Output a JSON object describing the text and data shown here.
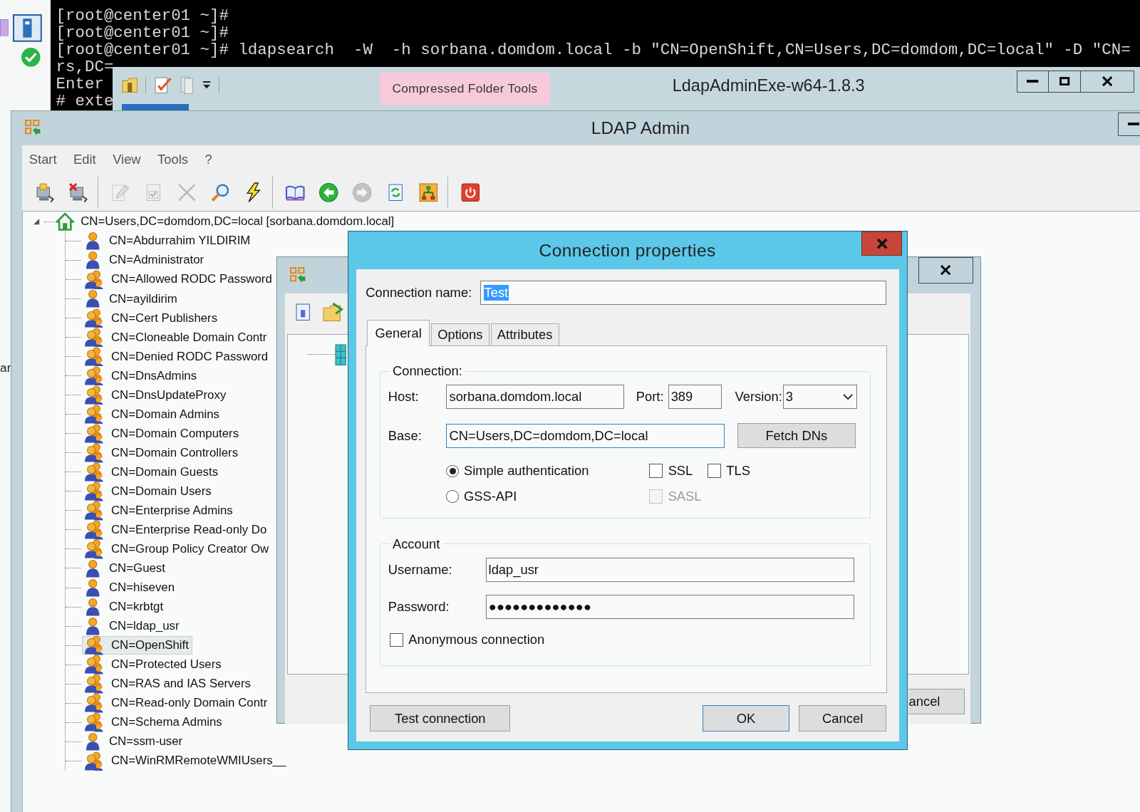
{
  "left_window": {
    "text_fragment": "ar"
  },
  "terminal": {
    "lines": [
      "[root@center01 ~]#",
      "[root@center01 ~]#",
      "[root@center01 ~]# ldapsearch  -W  -h sorbana.domdom.local -b \"CN=OpenShift,CN=Users,DC=domdom,DC=local\" -D \"CN=",
      "rs,DC=",
      "Enter",
      "# exte"
    ]
  },
  "explorer_window": {
    "ribbon_tab": "Compressed Folder Tools",
    "title": "LdapAdminExe-w64-1.8.3"
  },
  "ldap_admin": {
    "title": "LDAP Admin",
    "menu": [
      "Start",
      "Edit",
      "View",
      "Tools",
      "?"
    ],
    "toolbar_groups": [
      [
        {
          "kind": "connect",
          "disabled": false
        },
        {
          "kind": "disconnect",
          "disabled": false
        }
      ],
      [
        {
          "kind": "edit",
          "disabled": true
        },
        {
          "kind": "properties",
          "disabled": true
        },
        {
          "kind": "delete",
          "disabled": true
        },
        {
          "kind": "search",
          "disabled": false
        },
        {
          "kind": "execute",
          "disabled": false
        }
      ],
      [
        {
          "kind": "dictionary",
          "disabled": false
        },
        {
          "kind": "back",
          "disabled": false
        },
        {
          "kind": "forward",
          "disabled": true
        },
        {
          "kind": "refresh",
          "disabled": false
        },
        {
          "kind": "schema",
          "disabled": false
        }
      ],
      [
        {
          "kind": "exit",
          "disabled": false
        }
      ]
    ],
    "tree": {
      "label": "CN=Users,DC=domdom,DC=local [sorbana.domdom.local]",
      "expanded": true,
      "children": [
        {
          "label": "CN=Abdurrahim YILDIRIM",
          "kind": "user",
          "selected": false
        },
        {
          "label": "CN=Administrator",
          "kind": "user",
          "selected": false
        },
        {
          "label": "CN=Allowed RODC Password",
          "kind": "group",
          "selected": false
        },
        {
          "label": "CN=ayildirim",
          "kind": "user",
          "selected": false
        },
        {
          "label": "CN=Cert Publishers",
          "kind": "group",
          "selected": false
        },
        {
          "label": "CN=Cloneable Domain Contr",
          "kind": "group",
          "selected": false
        },
        {
          "label": "CN=Denied RODC Password",
          "kind": "group",
          "selected": false
        },
        {
          "label": "CN=DnsAdmins",
          "kind": "group",
          "selected": false
        },
        {
          "label": "CN=DnsUpdateProxy",
          "kind": "group",
          "selected": false
        },
        {
          "label": "CN=Domain Admins",
          "kind": "group",
          "selected": false
        },
        {
          "label": "CN=Domain Computers",
          "kind": "group",
          "selected": false
        },
        {
          "label": "CN=Domain Controllers",
          "kind": "group",
          "selected": false
        },
        {
          "label": "CN=Domain Guests",
          "kind": "group",
          "selected": false
        },
        {
          "label": "CN=Domain Users",
          "kind": "group",
          "selected": false
        },
        {
          "label": "CN=Enterprise Admins",
          "kind": "group",
          "selected": false
        },
        {
          "label": "CN=Enterprise Read-only Do",
          "kind": "group",
          "selected": false
        },
        {
          "label": "CN=Group Policy Creator Ow",
          "kind": "group",
          "selected": false
        },
        {
          "label": "CN=Guest",
          "kind": "user",
          "selected": false
        },
        {
          "label": "CN=hiseven",
          "kind": "user",
          "selected": false
        },
        {
          "label": "CN=krbtgt",
          "kind": "user",
          "selected": false
        },
        {
          "label": "CN=ldap_usr",
          "kind": "user",
          "selected": false
        },
        {
          "label": "CN=OpenShift",
          "kind": "group",
          "selected": true
        },
        {
          "label": "CN=Protected Users",
          "kind": "group",
          "selected": false
        },
        {
          "label": "CN=RAS and IAS Servers",
          "kind": "group",
          "selected": false
        },
        {
          "label": "CN=Read-only Domain Contr",
          "kind": "group",
          "selected": false
        },
        {
          "label": "CN=Schema Admins",
          "kind": "group",
          "selected": false
        },
        {
          "label": "CN=ssm-user",
          "kind": "user",
          "selected": false
        },
        {
          "label": "CN=WinRMRemoteWMIUsers__",
          "kind": "group",
          "selected": false
        }
      ]
    }
  },
  "background_window": {
    "button": "ancel"
  },
  "dialog": {
    "title": "Connection properties",
    "connection_name": {
      "label": "Connection name:",
      "value": "Test",
      "highlighted": true
    },
    "tabs": [
      {
        "label": "General",
        "selected": true
      },
      {
        "label": "Options",
        "selected": false
      },
      {
        "label": "Attributes",
        "selected": false
      }
    ],
    "connection_group": {
      "legend": "Connection:",
      "host": {
        "label": "Host:",
        "value": "sorbana.domdom.local"
      },
      "port": {
        "label": "Port:",
        "value": "389"
      },
      "version": {
        "label": "Version:",
        "value": "3"
      },
      "base": {
        "label": "Base:",
        "value": "CN=Users,DC=domdom,DC=local"
      },
      "fetch_button": "Fetch DNs",
      "auth_options": [
        {
          "label": "Simple authentication",
          "selected": true
        },
        {
          "label": "GSS-API",
          "selected": false
        }
      ],
      "security_options": [
        {
          "label": "SSL",
          "checked": false,
          "disabled": false
        },
        {
          "label": "TLS",
          "checked": false,
          "disabled": false
        },
        {
          "label": "SASL",
          "checked": false,
          "disabled": true
        }
      ]
    },
    "account_group": {
      "legend": "Account",
      "username": {
        "label": "Username:",
        "value": "ldap_usr"
      },
      "password": {
        "label": "Password:",
        "value": "●●●●●●●●●●●●●"
      },
      "anonymous": {
        "label": "Anonymous connection",
        "checked": false
      }
    },
    "buttons": [
      {
        "label": "Test connection",
        "default": false
      },
      {
        "label": "OK",
        "default": true
      },
      {
        "label": "Cancel",
        "default": false
      }
    ]
  }
}
